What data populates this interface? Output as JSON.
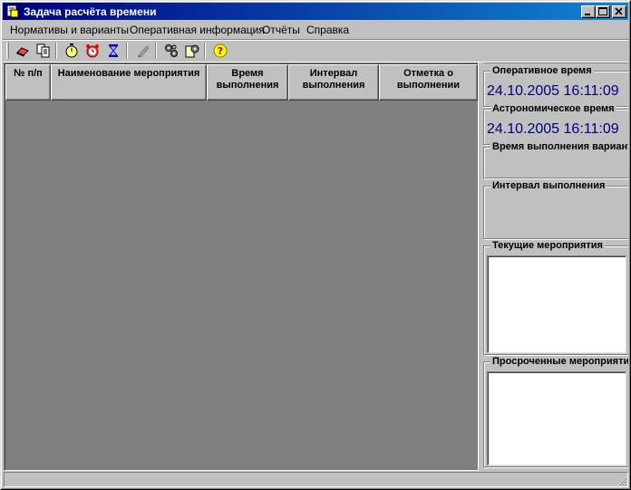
{
  "window": {
    "title": "Задача расчёта времени"
  },
  "menu": [
    {
      "label": "Нормативы и варианты"
    },
    {
      "label": "Оперативная информация"
    },
    {
      "label": "Отчёты"
    },
    {
      "label": "Справка"
    }
  ],
  "toolbar": {
    "icons": [
      "eraser-icon",
      "copy-documents-icon",
      "stopwatch-icon",
      "alarm-clock-icon",
      "hourglass-icon",
      "pen-icon",
      "gears-icon",
      "settings-book-icon",
      "help-icon"
    ]
  },
  "grid": {
    "columns": [
      {
        "label": "№ п/п"
      },
      {
        "label": "Наименование мероприятия"
      },
      {
        "label": "Время выполнения"
      },
      {
        "label": "Интервал выполнения"
      },
      {
        "label": "Отметка о выполнении"
      }
    ],
    "rows": []
  },
  "right_panel": {
    "operational_time": {
      "title": "Оперативное время",
      "value": "24.10.2005 16:11:09"
    },
    "astronomical_time": {
      "title": "Астрономическое время",
      "value": "24.10.2005 16:11:09"
    },
    "variant_time": {
      "title": "Время выполнения варианта"
    },
    "interval": {
      "title": "Интервал выполнения"
    },
    "current_events": {
      "title": "Текущие мероприятия"
    },
    "overdue_events": {
      "title": "Просроченные мероприятия"
    }
  },
  "colors": {
    "titlebar_start": "#000080",
    "titlebar_end": "#1084d0",
    "time_value": "#000080",
    "grid_background": "#808080",
    "face": "#c0c0c0"
  }
}
